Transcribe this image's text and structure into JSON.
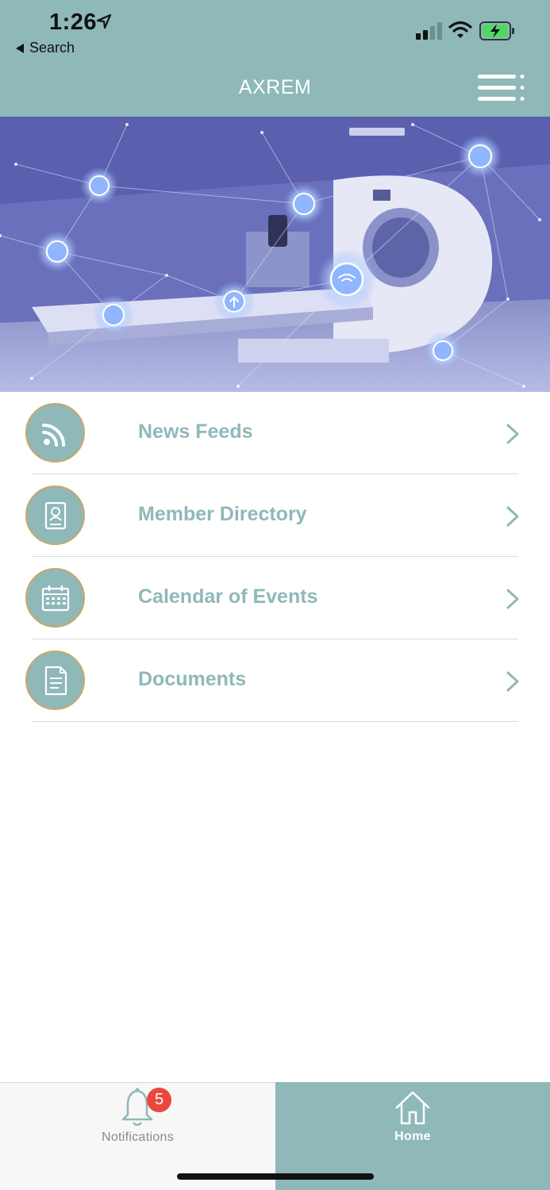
{
  "status_bar": {
    "time": "1:26",
    "back_label": "Search"
  },
  "header": {
    "title": "AXREM",
    "background_color": "#8fb8b9"
  },
  "hero": {
    "description_icon_names": [
      "network-node-icons"
    ]
  },
  "menu": {
    "items": [
      {
        "label": "News Feeds",
        "icon": "rss-icon"
      },
      {
        "label": "Member Directory",
        "icon": "contact-book-icon"
      },
      {
        "label": "Calendar of Events",
        "icon": "calendar-icon"
      },
      {
        "label": "Documents",
        "icon": "document-icon"
      }
    ],
    "label_color": "#8fb8b9"
  },
  "tabbar": {
    "notifications_label": "Notifications",
    "notifications_badge": "5",
    "home_label": "Home",
    "active_tab": "Home"
  }
}
